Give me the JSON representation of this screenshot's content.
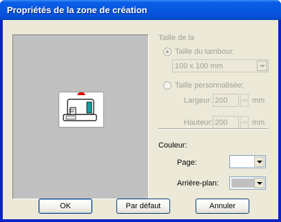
{
  "window": {
    "title": "Propriétés de la zone de création"
  },
  "size_group": {
    "label": "Taille de la",
    "hoop_radio": {
      "label": "Taille du tambour:",
      "checked": true
    },
    "hoop_select": {
      "value": "100 x 100 mm"
    },
    "custom_radio": {
      "label": "Taille personnalisée:",
      "checked": false
    },
    "width": {
      "label": "Largeur:",
      "value": "200",
      "unit": "mm"
    },
    "height": {
      "label": "Hauteur:",
      "value": "200",
      "unit": "mm"
    }
  },
  "color_group": {
    "label": "Couleur:",
    "page": {
      "label": "Page:",
      "color": "#ffffff"
    },
    "background": {
      "label": "Arrière-plan:",
      "color": "#c0c0c0"
    }
  },
  "buttons": {
    "ok": "OK",
    "default": "Par défaut",
    "cancel": "Annuler"
  },
  "icons": {
    "preview": "sewing-machine-icon"
  }
}
